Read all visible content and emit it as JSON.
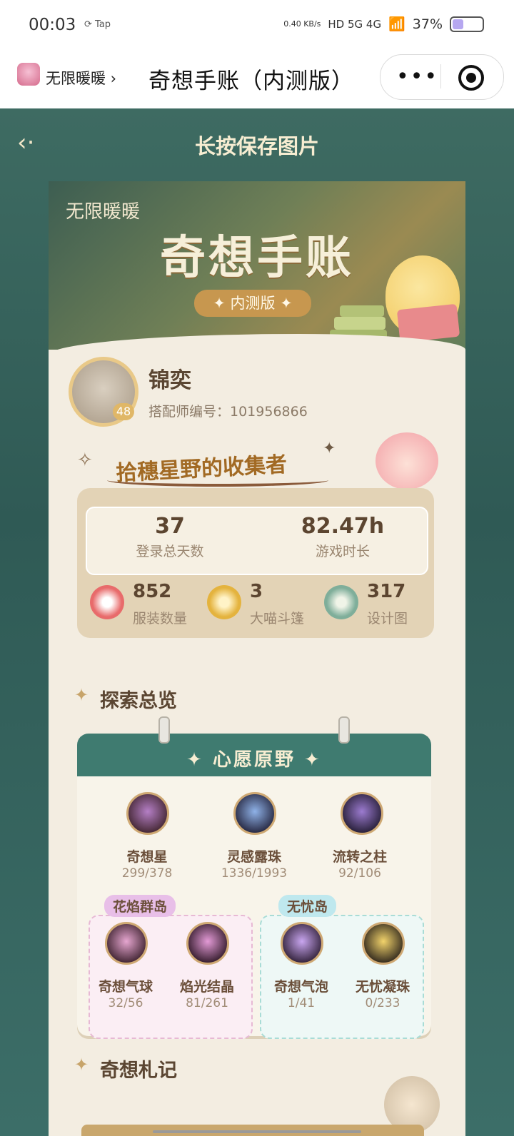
{
  "status_bar": {
    "time": "00:03",
    "tap_label": "Tap",
    "net_speed": "0.40 KB/s",
    "network": "HD 5G 4G",
    "battery": "37%"
  },
  "nav": {
    "mini_app_name": "无限暖暖 ›",
    "title": "奇想手账（内测版）",
    "more": "•••"
  },
  "page": {
    "heading": "长按保存图片"
  },
  "banner": {
    "brand": "无限暖暖",
    "title": "奇想手账",
    "beta": "✦ 内测版 ✦"
  },
  "profile": {
    "name": "锦奕",
    "id_text": "搭配师编号：101956866",
    "level": "48",
    "title": "拾穗星野的收集者"
  },
  "stats": {
    "login_days": "37",
    "login_days_label": "登录总天数",
    "play_time": "82.47h",
    "play_time_label": "游戏时长",
    "outfits": "852",
    "outfits_label": "服装数量",
    "cloaks": "3",
    "cloaks_label": "大喵斗篷",
    "blueprints": "317",
    "blueprints_label": "设计图"
  },
  "explore": {
    "heading": "探索总览",
    "panel_title": "✦ 心愿原野 ✦",
    "items": [
      {
        "name": "奇想星",
        "count": "299/378"
      },
      {
        "name": "灵感露珠",
        "count": "1336/1993"
      },
      {
        "name": "流转之柱",
        "count": "92/106"
      }
    ],
    "islands": [
      {
        "name": "花焰群岛",
        "items": [
          {
            "name": "奇想气球",
            "count": "32/56"
          },
          {
            "name": "焰光结晶",
            "count": "81/261"
          }
        ]
      },
      {
        "name": "无忧岛",
        "items": [
          {
            "name": "奇想气泡",
            "count": "1/41"
          },
          {
            "name": "无忧凝珠",
            "count": "0/233"
          }
        ]
      }
    ]
  },
  "notes": {
    "heading": "奇想札记"
  }
}
